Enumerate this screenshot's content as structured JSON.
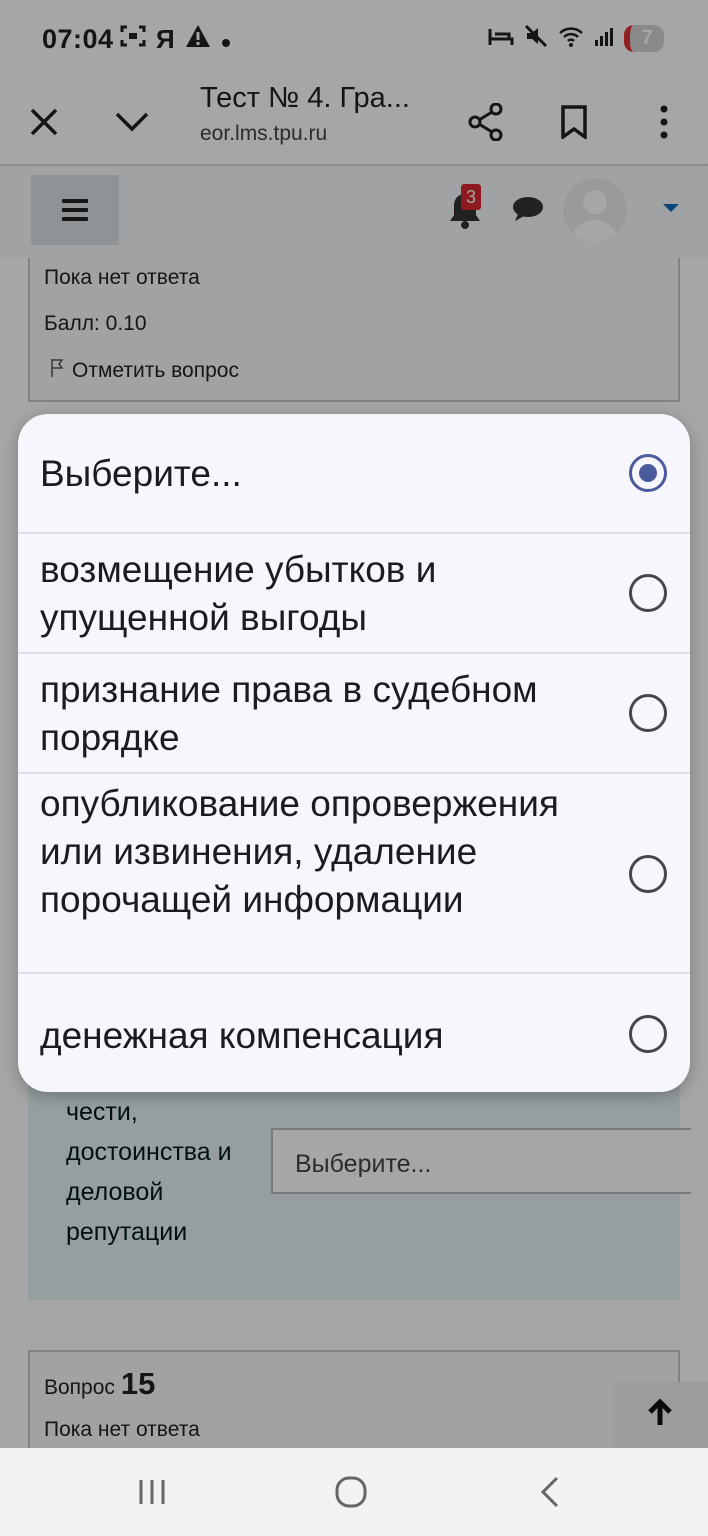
{
  "status_bar": {
    "time": "07:04",
    "left_icons": [
      "screenshot-icon",
      "yandex-icon",
      "warning-icon",
      "dot-icon"
    ],
    "yandex_glyph": "Я",
    "battery_level": "7"
  },
  "browser": {
    "tab_title": "Тест № 4. Гра...",
    "url": "eor.lms.tpu.ru"
  },
  "navbar": {
    "notification_count": "3",
    "accent_color": "#0f6cbf"
  },
  "question_above": {
    "status": "Пока нет ответа",
    "score": "Балл: 0.10",
    "flag_label": "Отметить вопрос"
  },
  "question_body": {
    "label": "чести, достоинства и деловой репутации",
    "select_placeholder": "Выберите..."
  },
  "question_next": {
    "prefix": "Вопрос",
    "number": "15",
    "status": "Пока нет ответа"
  },
  "dropdown": {
    "selected_index": 0,
    "options": [
      {
        "label": "Выберите..."
      },
      {
        "label": "возмещение убытков и упущенной выгоды"
      },
      {
        "label": "признание права в судебном порядке"
      },
      {
        "label": "опубликование опровержения или извинения, удаление порочащей информации"
      },
      {
        "label": "денежная компенсация"
      }
    ]
  }
}
